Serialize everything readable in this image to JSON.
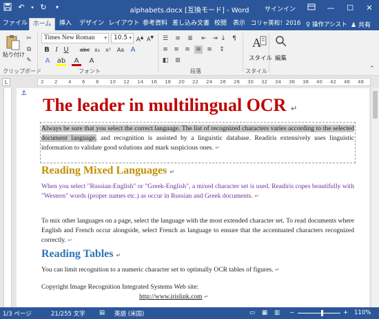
{
  "titlebar": {
    "title": "alphabets.docx [互換モード] - Word",
    "signin": "サインイン",
    "qat": [
      "save-icon",
      "undo-icon",
      "redo-icon",
      "customize-icon"
    ]
  },
  "tabs": [
    {
      "label": "ファイル",
      "active": false
    },
    {
      "label": "ホーム",
      "active": true
    },
    {
      "label": "挿入",
      "active": false
    },
    {
      "label": "デザイン",
      "active": false
    },
    {
      "label": "レイアウト",
      "active": false
    },
    {
      "label": "参考資料",
      "active": false
    },
    {
      "label": "差し込み文書",
      "active": false
    },
    {
      "label": "校閲",
      "active": false
    },
    {
      "label": "表示",
      "active": false
    },
    {
      "label": "コリャ英和！2016",
      "active": false
    }
  ],
  "tell_me": "操作アシスト",
  "share": "共有",
  "ribbon": {
    "paste_label": "貼り付け",
    "clipboard_group": "クリップボード",
    "font_name": "Times New Roman",
    "font_size": "10.5",
    "font_group": "フォント",
    "paragraph_group": "段落",
    "styles_label": "スタイル",
    "styles_group": "スタイル",
    "edit_label": "編集",
    "bold": "B",
    "italic": "I",
    "underline": "U",
    "strike": "abc",
    "sub": "x₂",
    "sup": "x²",
    "aa": "Aa",
    "fontcolor": "A",
    "clear": "A"
  },
  "ruler": {
    "numbers": [
      "2",
      "2",
      "4",
      "6",
      "8",
      "10",
      "12",
      "14",
      "16",
      "18",
      "20",
      "22",
      "24",
      "26",
      "28",
      "30",
      "32",
      "34",
      "36",
      "38",
      "40",
      "42",
      "46",
      "48"
    ]
  },
  "document": {
    "title": "The leader in multilingual OCR",
    "p1_highlight": "Always be sure that you select the correct language. The list of recognized characters varies according to the selected document language,",
    "p1_rest": " and recognition is assisted by a linguistic database. Readiris extensively uses linguistic information to validate good solutions and mark suspicious ones.",
    "h2_mixed": "Reading Mixed Languages",
    "p_mixed": "When you select \"Russian-English\" or \"Greek-English\", a mixed character set is used. Readiris copes beautifully with \"Western\" words (proper names etc.) as occur in Russian and Greek documents.",
    "p_other": "To mix other languages on a page, select the language with the most extended character set. To read documents where English and French occur alongside, select French as language to ensure that the accentuated characters recognized correctly.",
    "h2_tables": "Reading Tables",
    "p_tables": "You can limit recognition to a numeric character set to optimally OCR tables of figures.",
    "copyright": "Copyright Image Recognition Integrated Systems Web site:",
    "url": "http://www.irislink.com"
  },
  "colors": {
    "brand": "#2b579a",
    "title_red": "#c00000",
    "heading_gold": "#c09000",
    "heading_blue": "#2e74b5",
    "purple": "#7030a0"
  },
  "statusbar": {
    "page": "1/3 ページ",
    "words": "21/255 文字",
    "language": "英語 (米国)",
    "zoom": "110%"
  }
}
